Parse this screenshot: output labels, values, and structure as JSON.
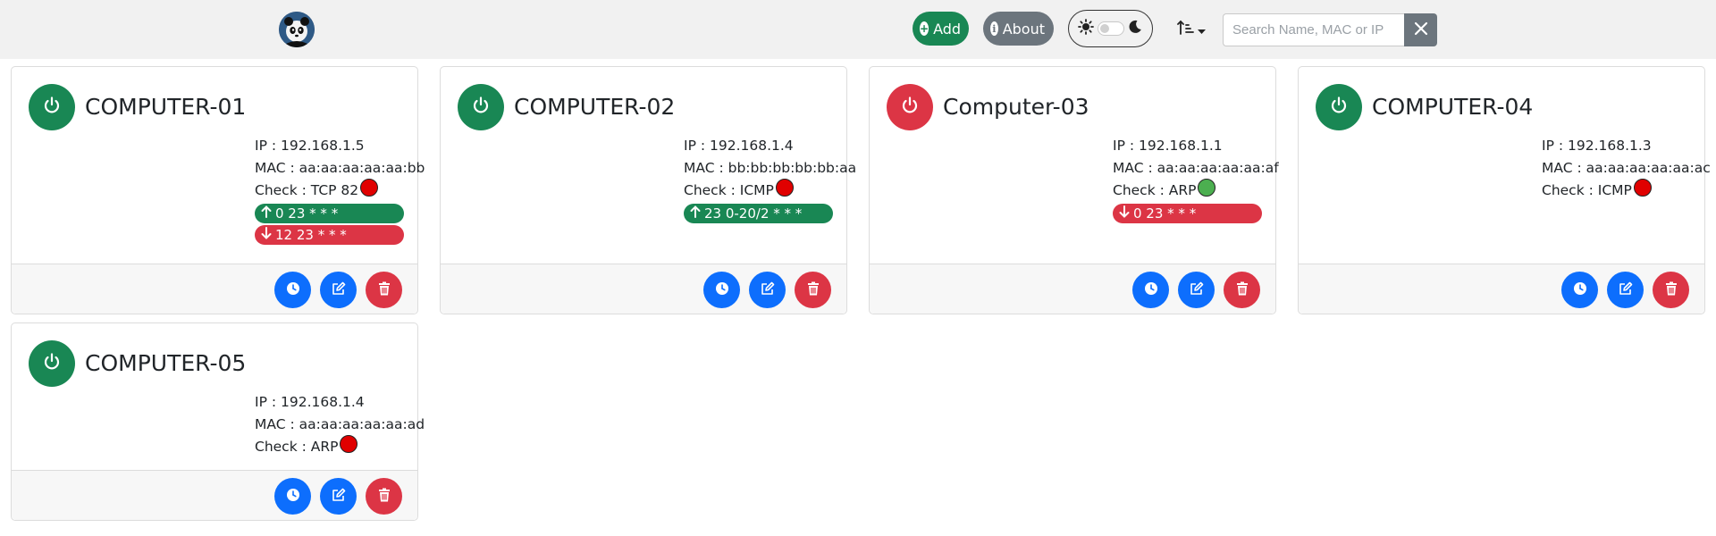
{
  "navbar": {
    "add_label": "Add",
    "about_label": "About",
    "search_placeholder": "Search Name, MAC or IP",
    "search_value": ""
  },
  "colors": {
    "on": "#198754",
    "off": "#dc3545",
    "blue": "#0d6efd",
    "status_ok": "#4caf50",
    "status_fail": "#e00000"
  },
  "icons": [
    "logo-panda-icon",
    "plus-circle-icon",
    "info-icon",
    "sun-icon",
    "moon-icon",
    "sort-icon",
    "close-icon",
    "power-icon",
    "clock-icon",
    "edit-icon",
    "trash-icon",
    "arrow-up-icon",
    "arrow-down-icon"
  ],
  "devices": [
    {
      "name": "COMPUTER-01",
      "power": "on",
      "ip": "IP : 192.168.1.5",
      "mac": "MAC : aa:aa:aa:aa:aa:bb",
      "check": "Check : TCP 82",
      "check_status": "fail",
      "schedules": [
        {
          "dir": "up",
          "text": "0 23 * * *"
        },
        {
          "dir": "down",
          "text": "12 23 * * *"
        }
      ]
    },
    {
      "name": "COMPUTER-02",
      "power": "on",
      "ip": "IP : 192.168.1.4",
      "mac": "MAC : bb:bb:bb:bb:bb:aa",
      "check": "Check : ICMP",
      "check_status": "fail",
      "schedules": [
        {
          "dir": "up",
          "text": "23 0-20/2 * * *"
        }
      ]
    },
    {
      "name": "Computer-03",
      "power": "off",
      "ip": "IP : 192.168.1.1",
      "mac": "MAC : aa:aa:aa:aa:aa:af",
      "check": "Check : ARP",
      "check_status": "ok",
      "schedules": [
        {
          "dir": "down",
          "text": "0 23 * * *"
        }
      ]
    },
    {
      "name": "COMPUTER-04",
      "power": "on",
      "ip": "IP : 192.168.1.3",
      "mac": "MAC : aa:aa:aa:aa:aa:ac",
      "check": "Check : ICMP",
      "check_status": "fail",
      "schedules": []
    },
    {
      "name": "COMPUTER-05",
      "power": "on",
      "ip": "IP : 192.168.1.4",
      "mac": "MAC : aa:aa:aa:aa:aa:ad",
      "check": "Check : ARP",
      "check_status": "fail",
      "schedules": []
    }
  ]
}
